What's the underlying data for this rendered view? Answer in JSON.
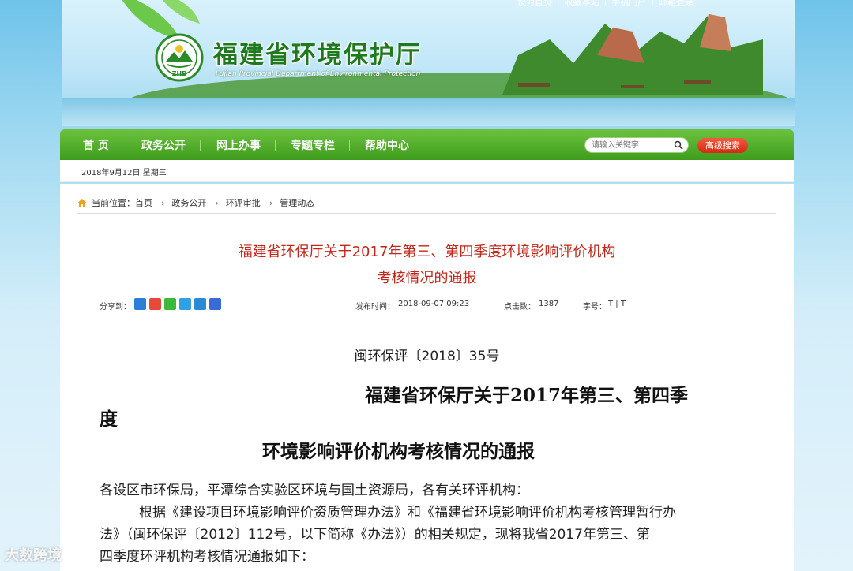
{
  "header": {
    "top_links": [
      "设为首页",
      "收藏本站",
      "手机门户",
      "邮箱登录"
    ],
    "site_title": "福建省环境保护厅",
    "site_subtitle": "Fujian Provincial Department of Environmental Protection",
    "logo_text": "ZHB"
  },
  "nav": {
    "items": [
      "首 页",
      "政务公开",
      "网上办事",
      "专题专栏",
      "帮助中心"
    ],
    "search_placeholder": "请输入关键字",
    "advanced_search": "高级搜索"
  },
  "datebar": {
    "date": "2018年9月12日 星期三"
  },
  "breadcrumb": {
    "label": "当前位置：",
    "items": [
      "首页",
      "政务公开",
      "环评审批",
      "管理动态"
    ]
  },
  "article": {
    "title_line1": "福建省环保厅关于2017年第三、第四季度环境影响评价机构",
    "title_line2": "考核情况的通报",
    "share_label": "分享到：",
    "publish_time_label": "发布时间：",
    "publish_time": "2018-09-07 09:23",
    "clicks_label": "点击数：",
    "clicks": "1387",
    "font_size_label": "字号：",
    "font_size_options": "T | T",
    "doc_number": "闽环保评〔2018〕35号",
    "body_title_line1": "福建省环保厅关于2017年第三、第四季",
    "body_title_line1_tail": "度",
    "body_title_line2": "环境影响评价机构考核情况的通报",
    "para1": "各设区市环保局，平潭综合实验区环境与国土资源局，各有关环评机构：",
    "para2_line1": "根据《建设项目环境影响评价资质管理办法》和《福建省环境影响评价机构考核管理暂行办",
    "para2_line2": "法》（闽环保评〔2012〕112号，以下简称《办法》）的相关规定，现将我省2017年第三、第",
    "para2_line3": "四季度环评机构考核情况通报如下："
  },
  "watermark": "大数跨境",
  "colors": {
    "nav_green": "#4caf2a",
    "title_red": "#c1271a",
    "adv_search_red": "#e0391c",
    "site_title_green": "#1f7a1f"
  }
}
